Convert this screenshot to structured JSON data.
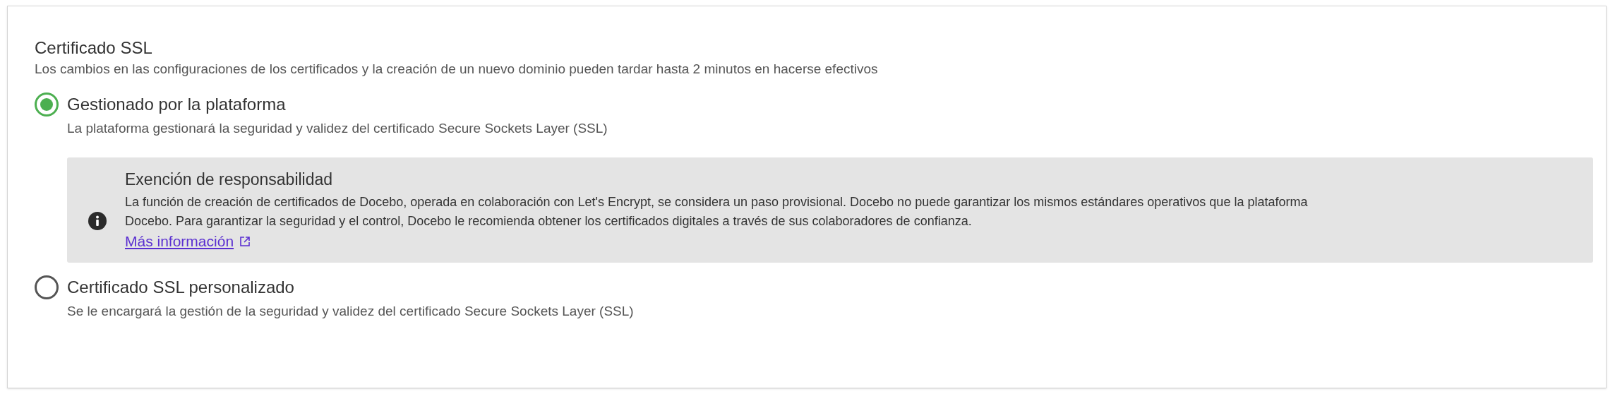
{
  "section": {
    "title": "Certificado SSL",
    "description": "Los cambios en las configuraciones de los certificados y la creación de un nuevo dominio pueden tardar hasta 2 minutos en hacerse efectivos"
  },
  "options": [
    {
      "label": "Gestionado por la plataforma",
      "description": "La plataforma gestionará la seguridad y validez del certificado Secure Sockets Layer (SSL)",
      "selected": true,
      "notice": {
        "title": "Exención de responsabilidad",
        "text": "La función de creación de certificados de Docebo, operada en colaboración con Let's Encrypt, se considera un paso provisional. Docebo no puede garantizar los mismos estándares operativos que la plataforma Docebo. Para garantizar la seguridad y el control, Docebo le recomienda obtener los certificados digitales a través de sus colaboradores de confianza.",
        "link": "Más información"
      }
    },
    {
      "label": "Certificado SSL personalizado",
      "description": "Se le encargará la gestión de la seguridad y validez del certificado Secure Sockets Layer (SSL)",
      "selected": false
    }
  ]
}
